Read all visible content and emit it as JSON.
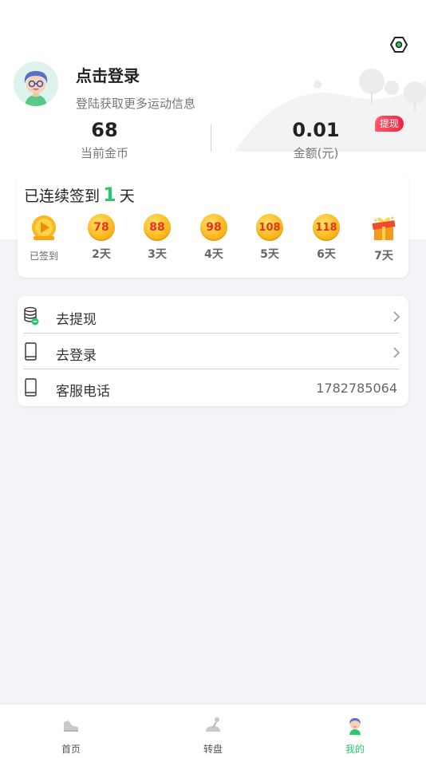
{
  "header": {
    "settings_icon": "settings-hexagon-icon",
    "login_title": "点击登录",
    "login_subtitle": "登陆获取更多运动信息"
  },
  "stats": {
    "coins_value": "68",
    "coins_label": "当前金币",
    "amount_value": "0.01",
    "amount_label": "金额(元)",
    "withdraw_badge": "提现"
  },
  "checkin": {
    "prefix": "已连续签到",
    "days": "1",
    "suffix": "天",
    "items": [
      {
        "coin": "",
        "label": "已签到",
        "done": true
      },
      {
        "coin": "78",
        "label": "2天"
      },
      {
        "coin": "88",
        "label": "3天"
      },
      {
        "coin": "98",
        "label": "4天"
      },
      {
        "coin": "108",
        "label": "5天"
      },
      {
        "coin": "118",
        "label": "6天"
      },
      {
        "coin": "",
        "label": "7天",
        "gift": true
      }
    ]
  },
  "menu": {
    "withdraw_label": "去提现",
    "login_label": "去登录",
    "service_label": "客服电话",
    "service_phone": "1782785064"
  },
  "tabbar": {
    "home_label": "首页",
    "wheel_label": "转盘",
    "mine_label": "我的"
  },
  "colors": {
    "accent": "#2bc76a",
    "badge": "#f0233e",
    "coin": "#fbb71c"
  }
}
